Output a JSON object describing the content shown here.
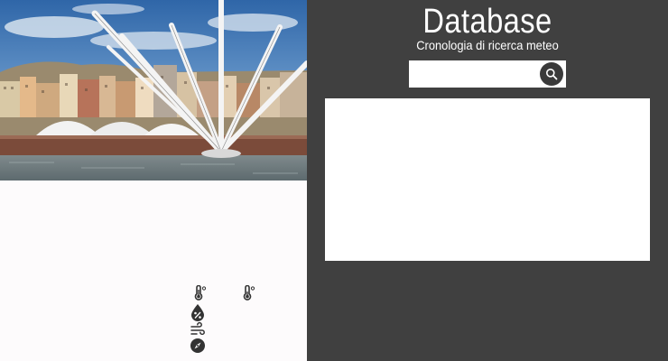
{
  "left_panel": {
    "photo": {
      "subject": "genoa-harbor-bigo-photo"
    },
    "weather": {
      "temp_min": {
        "icon": "thermometer-icon",
        "value": ""
      },
      "temp_max": {
        "icon": "thermometer-icon",
        "value": ""
      },
      "humidity": {
        "icon": "humidity-icon",
        "value": ""
      },
      "wind": {
        "icon": "wind-icon",
        "value": ""
      },
      "direction": {
        "icon": "compass-icon",
        "value": ""
      },
      "unit": "°"
    }
  },
  "right_panel": {
    "title": "Database",
    "subtitle": "Cronologia di ricerca meteo",
    "search": {
      "value": "",
      "placeholder": "",
      "button_icon": "search-icon"
    },
    "results": []
  },
  "colors": {
    "right_bg": "#404040",
    "left_bg": "#fdfbfc",
    "search_button": "#3a3a3a"
  }
}
